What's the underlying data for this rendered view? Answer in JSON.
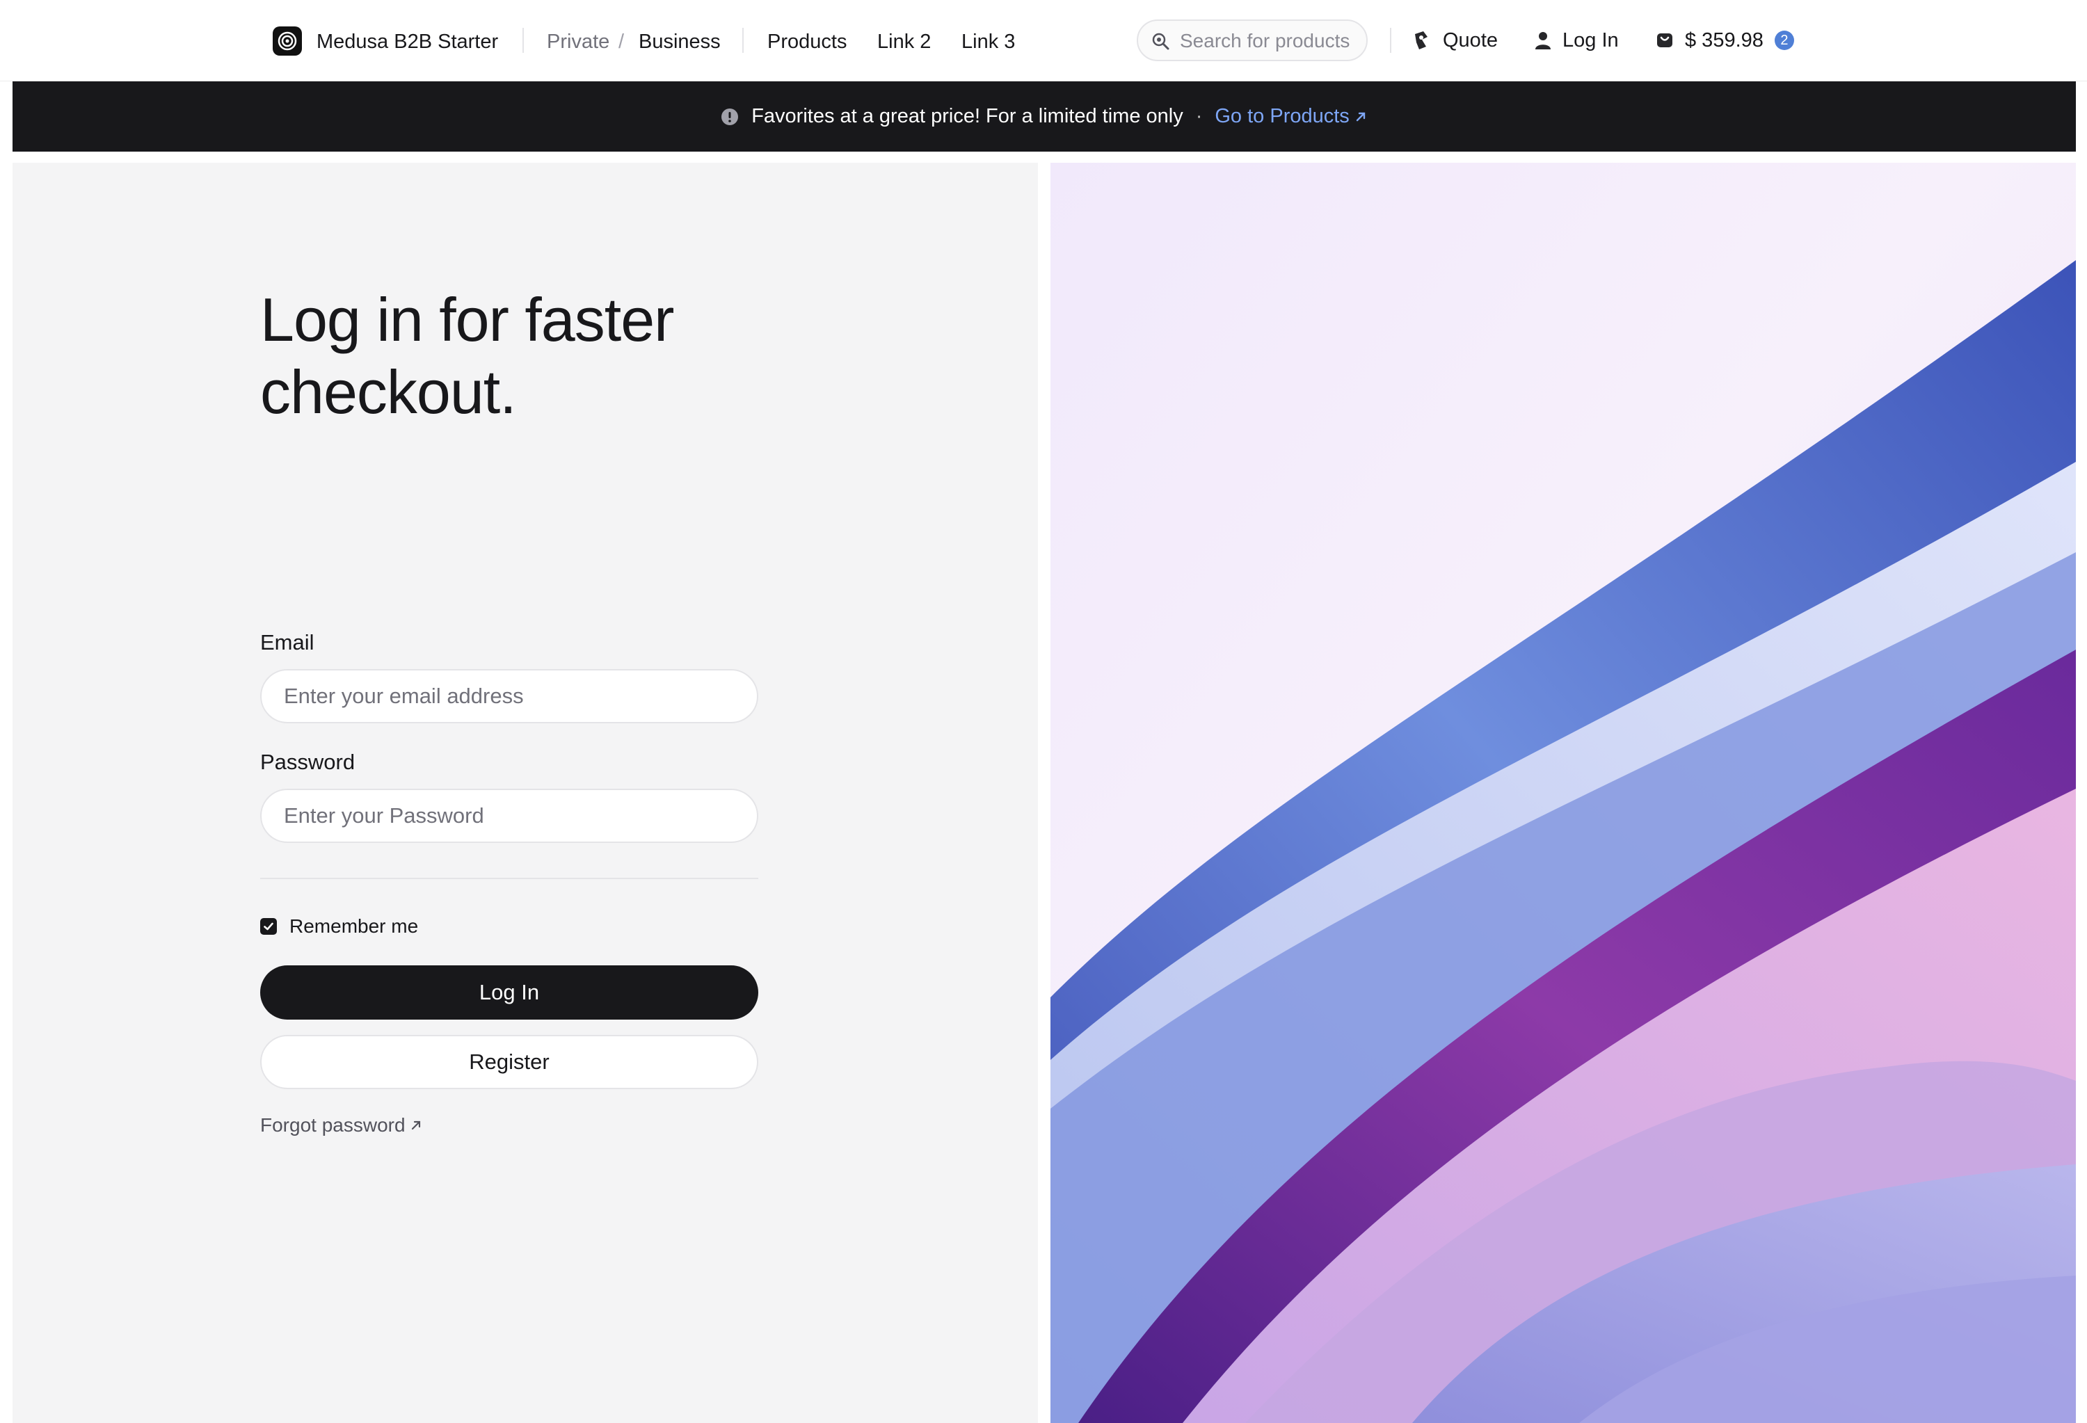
{
  "header": {
    "brand": "Medusa B2B Starter",
    "breadcrumb": {
      "private": "Private",
      "separator": "/",
      "business": "Business"
    },
    "nav": [
      "Products",
      "Link 2",
      "Link 3"
    ],
    "search": {
      "placeholder": "Search for products",
      "value": ""
    },
    "quote_label": "Quote",
    "login_label": "Log In",
    "cart": {
      "total": "$ 359.98",
      "count": "2"
    }
  },
  "banner": {
    "text": "Favorites at a great price! For a limited time only",
    "separator": "·",
    "link_label": "Go to Products"
  },
  "login": {
    "title": "Log in for faster checkout.",
    "email_label": "Email",
    "email_placeholder": "Enter your email address",
    "password_label": "Password",
    "password_placeholder": "Enter your Password",
    "remember_label": "Remember me",
    "remember_checked": true,
    "login_button": "Log In",
    "register_button": "Register",
    "forgot_label": "Forgot password"
  },
  "colors": {
    "dark": "#18181b",
    "accent_link": "#7ea6f5",
    "badge": "#4f7fd6",
    "panel_bg": "#f4f4f5"
  },
  "icons": {
    "logo": "medusa-logo-icon",
    "search": "search-icon",
    "quote": "quote-icon",
    "user": "user-icon",
    "cart": "cart-icon",
    "alert": "alert-icon",
    "external": "arrow-up-right-icon",
    "check": "check-icon"
  }
}
